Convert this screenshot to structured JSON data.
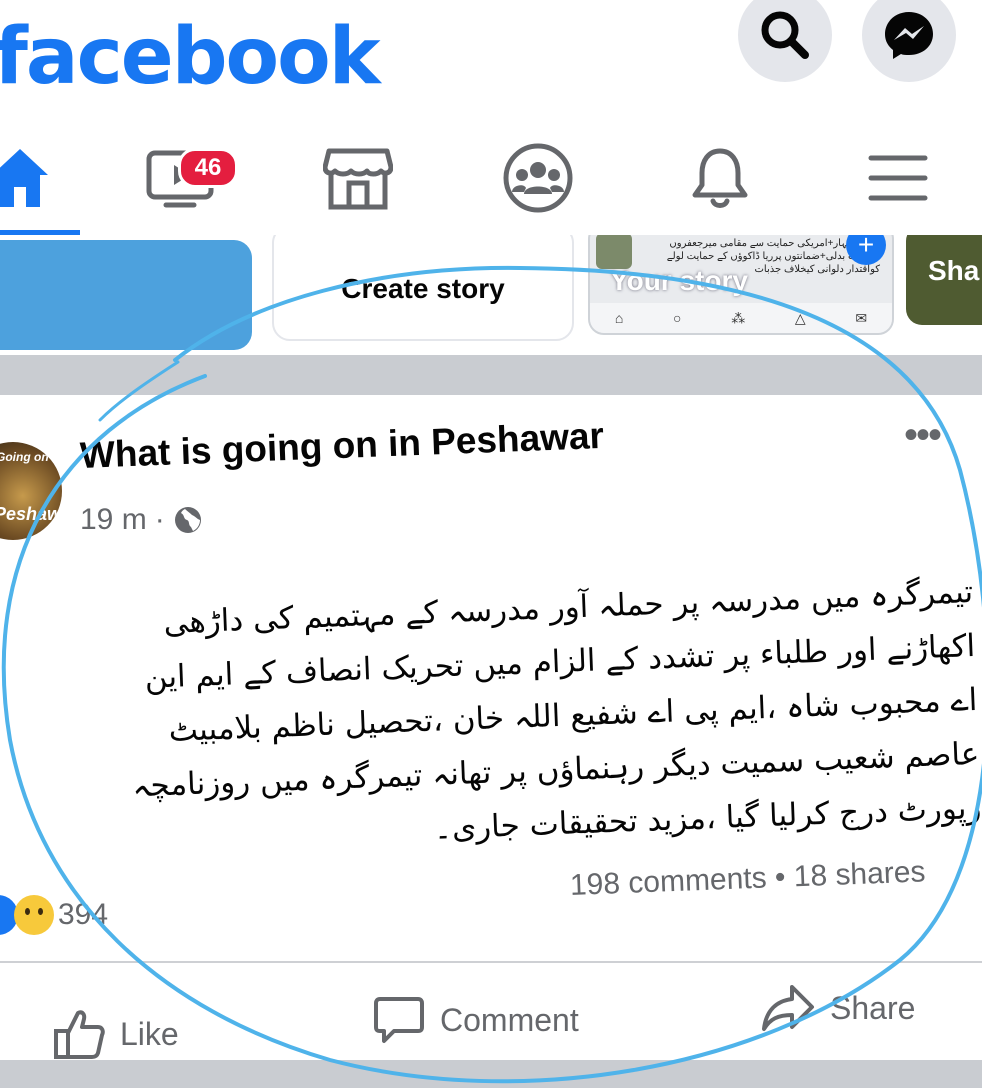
{
  "app": {
    "logo_text": "facebook",
    "brand_color": "#1877f2"
  },
  "header": {
    "search_icon": "search-icon",
    "messenger_icon": "messenger-icon"
  },
  "nav": {
    "items": [
      {
        "name": "home",
        "icon": "home-icon",
        "active": true
      },
      {
        "name": "watch",
        "icon": "video-icon",
        "badge": "46"
      },
      {
        "name": "marketplace",
        "icon": "store-icon"
      },
      {
        "name": "groups",
        "icon": "groups-icon"
      },
      {
        "name": "notifications",
        "icon": "bell-icon"
      },
      {
        "name": "menu",
        "icon": "hamburger-icon"
      }
    ],
    "badge_color": "#e41e3f"
  },
  "stories": {
    "create_label": "Create story",
    "your_story_label": "Your story",
    "your_story_snippet": "انکی اظہار+امریکی حمایت سے مقامی میرجعفروں حکومت بدلی+ضمانتوں پرریا ڈاکوؤں کے حمایت لولے کواقتدار دلوانی کیخلاف جذبات",
    "next_story_label": "Sha"
  },
  "post": {
    "page_name": "What is going on in Peshawar",
    "avatar_text": "Peshawar",
    "avatar_top_text": "Going on",
    "time": "19 m",
    "audience_icon": "globe-icon",
    "body_lines": [
      "تیمرگرہ میں مدرسہ پر حملہ آور مدرسہ کے مہتمیم کی داڑھی",
      "اکھاڑنے اور طلباء پر تشدد کے الزام میں تحریک انصاف کے ایم این",
      "اے محبوب شاہ ،ایم پی اے شفیع اللہ خان ،تحصیل ناظم بلامبیٹ",
      "عاصم شعیب سمیت دیگر رہنماؤں پر تھانہ تیمرگرہ میں روزنامچہ",
      "رپورٹ درج کرلیا گیا ،مزید تحقیقات جاری۔"
    ],
    "reaction_count": "394",
    "comments": "198 comments",
    "shares": "18 shares",
    "stats_separator": "•"
  },
  "actions": {
    "like_label": "Like",
    "comment_label": "Comment",
    "share_label": "Share"
  },
  "annotation": {
    "circle_color": "#4fb3ea"
  }
}
